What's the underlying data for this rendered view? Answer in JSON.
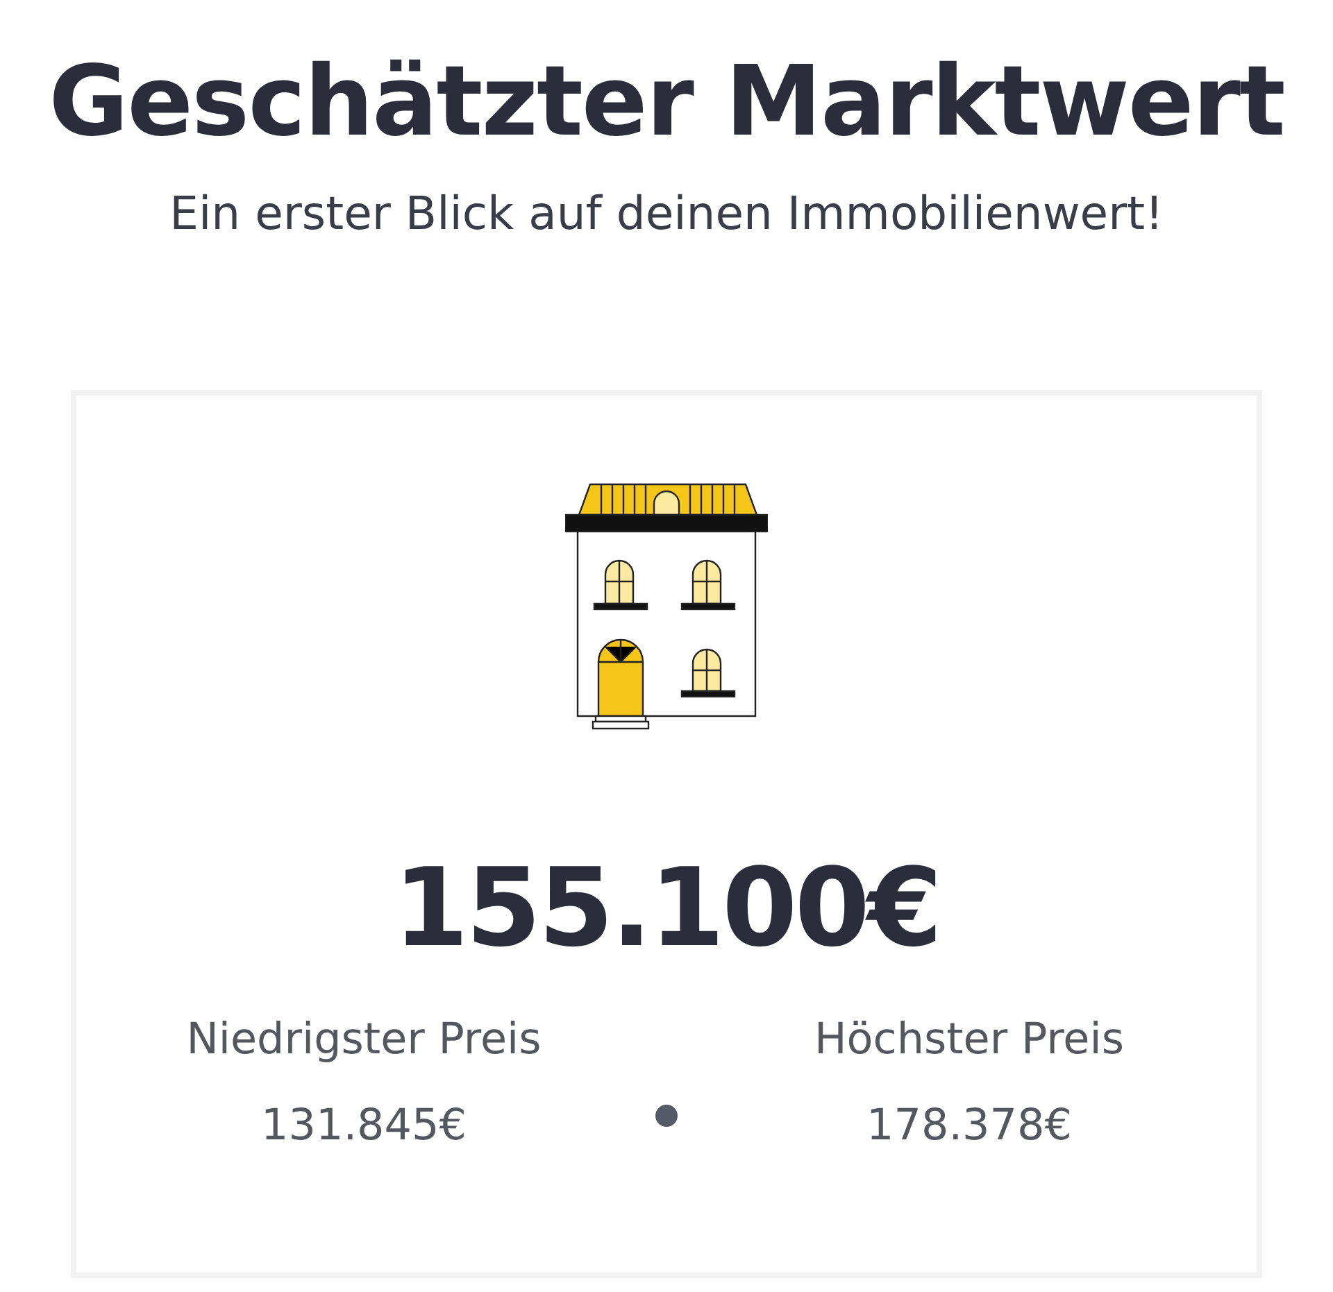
{
  "title": "Geschätzter Marktwert",
  "subtitle": "Ein erster Blick auf deinen Immobilienwert!",
  "estimate": {
    "value": "155.100€",
    "range": [
      {
        "label": "Niedrigster Preis",
        "value": "131.845€"
      },
      {
        "label": "Höchster Preis",
        "value": "178.378€"
      }
    ]
  }
}
